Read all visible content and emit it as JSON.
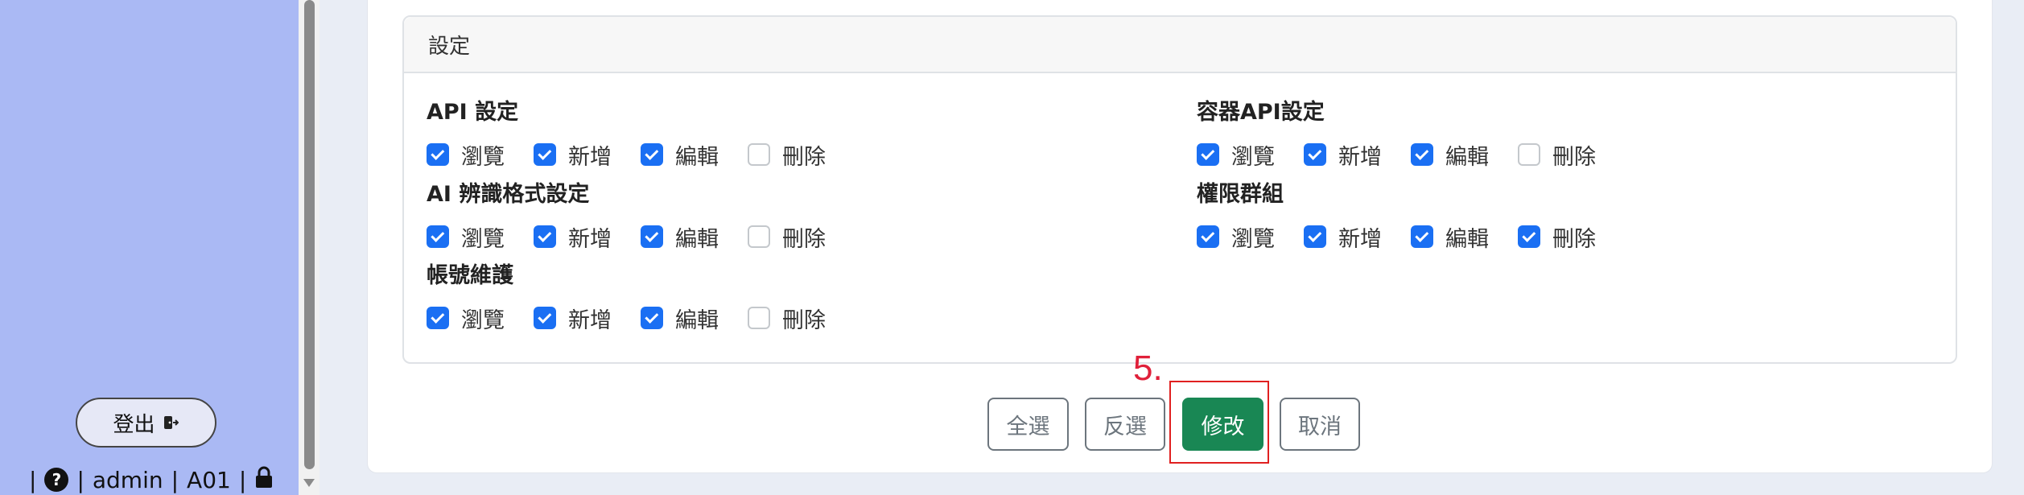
{
  "sidebar": {
    "logout_label": "登出",
    "user_separator": "|",
    "username": "admin",
    "org_code": "A01"
  },
  "settings": {
    "header": "設定",
    "groups": [
      {
        "title": "API 設定",
        "items": [
          {
            "label": "瀏覽",
            "checked": true
          },
          {
            "label": "新增",
            "checked": true
          },
          {
            "label": "編輯",
            "checked": true
          },
          {
            "label": "刪除",
            "checked": false
          }
        ]
      },
      {
        "title": "容器API設定",
        "items": [
          {
            "label": "瀏覽",
            "checked": true
          },
          {
            "label": "新增",
            "checked": true
          },
          {
            "label": "編輯",
            "checked": true
          },
          {
            "label": "刪除",
            "checked": false
          }
        ]
      },
      {
        "title": "AI 辨識格式設定",
        "items": [
          {
            "label": "瀏覽",
            "checked": true
          },
          {
            "label": "新增",
            "checked": true
          },
          {
            "label": "編輯",
            "checked": true
          },
          {
            "label": "刪除",
            "checked": false
          }
        ]
      },
      {
        "title": "權限群組",
        "items": [
          {
            "label": "瀏覽",
            "checked": true
          },
          {
            "label": "新增",
            "checked": true
          },
          {
            "label": "編輯",
            "checked": true
          },
          {
            "label": "刪除",
            "checked": true
          }
        ]
      },
      {
        "title": "帳號維護",
        "items": [
          {
            "label": "瀏覽",
            "checked": true
          },
          {
            "label": "新增",
            "checked": true
          },
          {
            "label": "編輯",
            "checked": true
          },
          {
            "label": "刪除",
            "checked": false
          }
        ]
      }
    ]
  },
  "actions": {
    "select_all": "全選",
    "invert": "反選",
    "modify": "修改",
    "cancel": "取消",
    "step_label": "5."
  },
  "colors": {
    "sidebar_bg": "#aab9f4",
    "checkbox_checked": "#1a6ff3",
    "save_button": "#198754",
    "annotation": "#e02020"
  }
}
